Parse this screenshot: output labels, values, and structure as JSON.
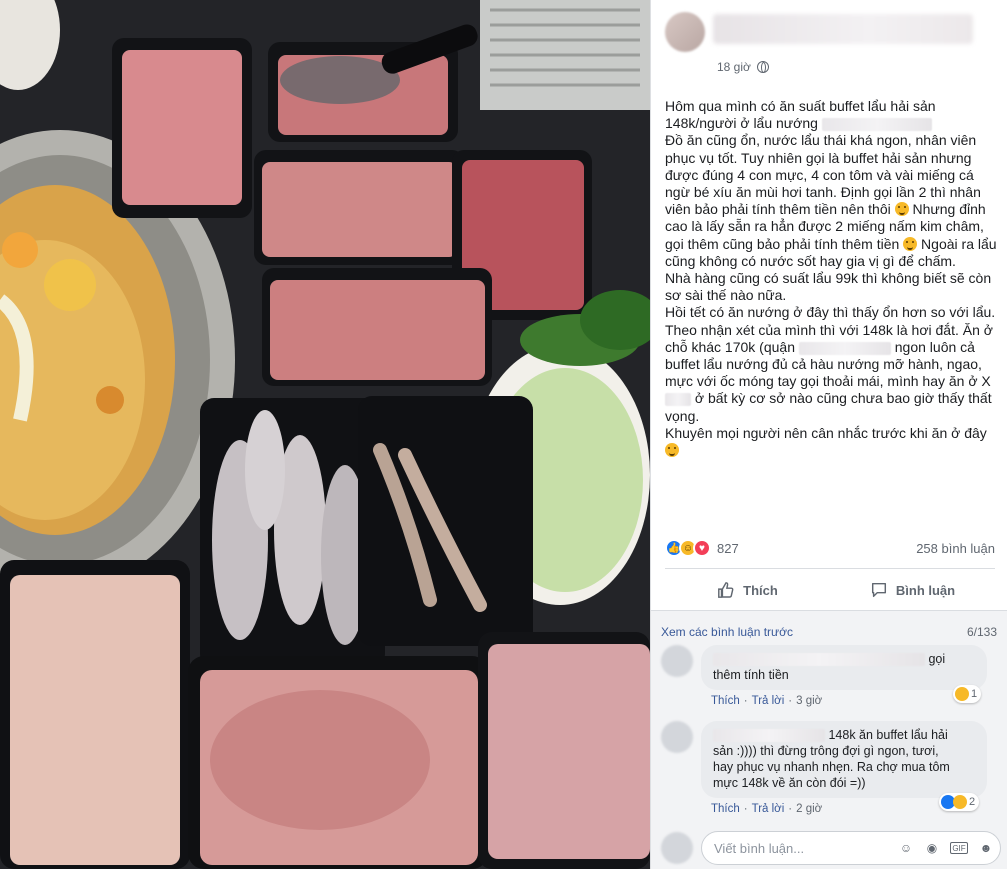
{
  "post": {
    "time": "18 giờ",
    "paragraphs": {
      "p1_a": "Hôm qua mình có ăn suất buffet lẩu hải sản 148k/người ở lẩu nướng ",
      "p2": "Đồ ăn cũng ổn, nước lẩu thái khá ngon, nhân viên phục vụ tốt. Tuy nhiên gọi là buffet hải sản nhưng được đúng 4 con mực, 4 con tôm và vài miếng cá ngừ bé xíu ăn mùi hơi tanh. Định gọi lần 2 thì nhân viên bảo phải tính thêm tiền nên thôi",
      "p2_b": " Nhưng đỉnh cao là lấy sẵn ra hẳn được 2 miếng nấm kim châm, gọi thêm cũng bảo phải tính thêm tiền",
      "p2_c": " Ngoài ra lẩu cũng không có nước sốt hay gia vị gì để chấm.",
      "p3": "Nhà hàng cũng có suất lẩu 99k thì không biết sẽ còn sơ sài thế nào nữa.",
      "p4": "Hồi tết có ăn nướng ở đây thì thấy ổn hơn so với lẩu.",
      "p5_a": "Theo nhận xét của mình thì với 148k là hơi đắt. Ăn ở chỗ khác 170k (quận ",
      "p5_b": " ngon luôn cả buffet lẩu nướng đủ cả hàu nướng mỡ hành, ngao, mực với ốc móng tay gọi thoải mái, mình hay ăn ở X",
      "p5_c": " ở bất kỳ cơ sở nào cũng chưa bao giờ thấy thất vọng.",
      "p6": "Khuyên mọi người nên cân nhắc trước khi ăn ở đây"
    },
    "reaction_count": "827",
    "comment_count": "258 bình luận",
    "like_label": "Thích",
    "comment_label": "Bình luận"
  },
  "comments": {
    "view_more": "Xem các bình luận trước",
    "page": "6/133",
    "items": [
      {
        "text_a": "gọi",
        "text_b": "thêm tính tiền",
        "like": "Thích",
        "reply": "Trả lời",
        "time": "3 giờ",
        "reactions": "1"
      },
      {
        "text_a": " 148k ăn buffet lẩu hải",
        "text_b": "sản :)))) thì đừng trông đợi gì ngon, tươi,",
        "text_c": "hay phục vụ nhanh nhẹn. Ra chợ mua tôm",
        "text_d": "mực 148k về ăn còn đói =))",
        "like": "Thích",
        "reply": "Trả lời",
        "time": "2 giờ",
        "reactions": "2"
      }
    ],
    "composer_placeholder": "Viết bình luận...",
    "gif_label": "GIF"
  },
  "colors": {
    "link": "#385898",
    "like_blue": "#1877f2",
    "haha_yellow": "#f7b928",
    "love_red": "#f33e58"
  }
}
